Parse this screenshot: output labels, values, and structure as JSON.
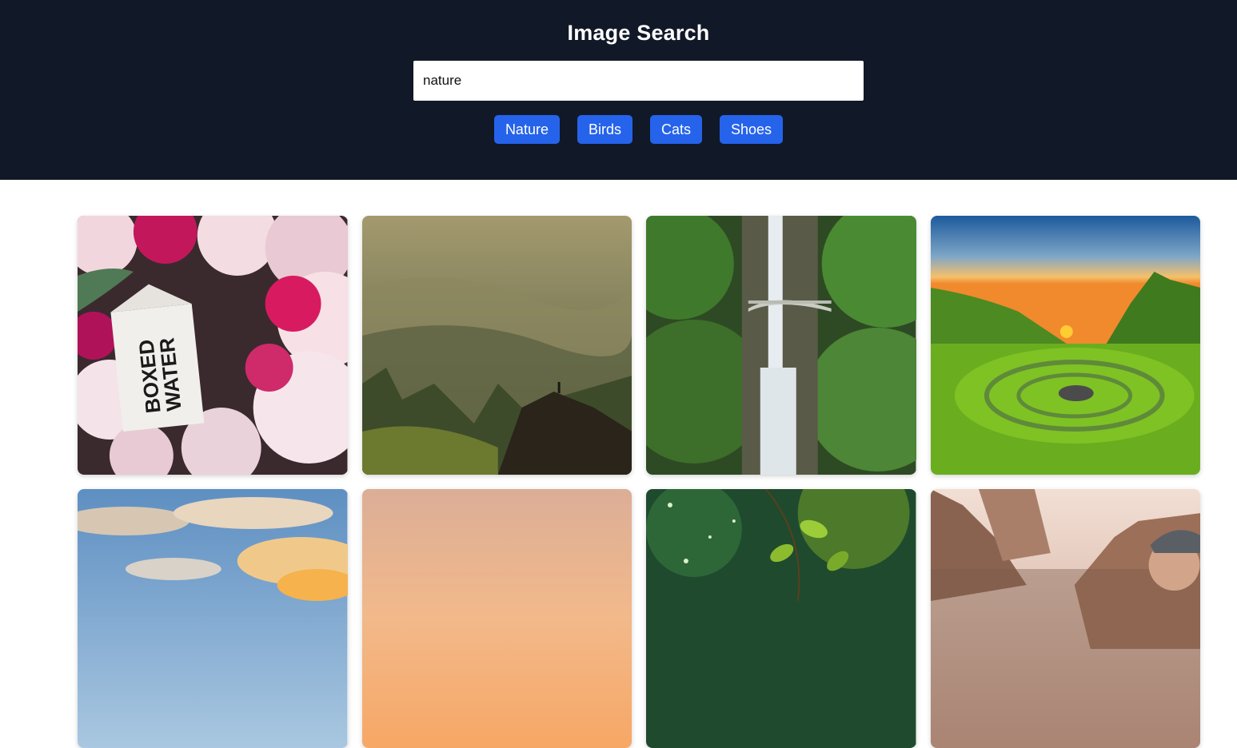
{
  "header": {
    "title": "Image Search",
    "search_value": "nature"
  },
  "chips": [
    {
      "label": "Nature"
    },
    {
      "label": "Birds"
    },
    {
      "label": "Cats"
    },
    {
      "label": "Shoes"
    }
  ],
  "results": [
    {
      "subject": "boxed water carton among pink flowers",
      "carton_text_1": "BOXED",
      "carton_text_2": "WATER"
    },
    {
      "subject": "misty mountain valley with hiker on rock"
    },
    {
      "subject": "waterfall with stone bridge in green gorge"
    },
    {
      "subject": "green valley at sunset with stone circles"
    },
    {
      "subject": "clouds over sky at sunrise"
    },
    {
      "subject": "peach sunset gradient sky"
    },
    {
      "subject": "green leaves with bokeh"
    },
    {
      "subject": "rocky cliffs with person in cap"
    }
  ],
  "colors": {
    "header_bg": "#111827",
    "chip_bg": "#2563eb",
    "page_bg": "#ffffff"
  }
}
